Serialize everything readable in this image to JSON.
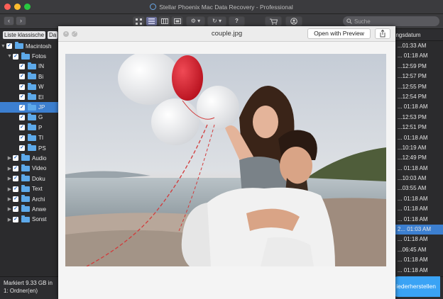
{
  "window": {
    "title": "Stellar Phoenix Mac Data Recovery - Professional"
  },
  "toolbar": {
    "back": "‹",
    "forward": "›",
    "search_placeholder": "Suche"
  },
  "tabs": [
    "Liste klassische",
    "Da"
  ],
  "tree": [
    {
      "label": "Macintosh",
      "level": 0,
      "expanded": true
    },
    {
      "label": "Fotos",
      "level": 1,
      "expanded": true
    },
    {
      "label": "IN",
      "level": 2
    },
    {
      "label": "Bi",
      "level": 2
    },
    {
      "label": "W",
      "level": 2
    },
    {
      "label": "El",
      "level": 2
    },
    {
      "label": "JP",
      "level": 2,
      "selected": true
    },
    {
      "label": "G",
      "level": 2
    },
    {
      "label": "P",
      "level": 2
    },
    {
      "label": "TI",
      "level": 2
    },
    {
      "label": "PS",
      "level": 2
    },
    {
      "label": "Audio",
      "level": 1,
      "expandable": true
    },
    {
      "label": "Video",
      "level": 1,
      "expandable": true
    },
    {
      "label": "Doku",
      "level": 1,
      "expandable": true
    },
    {
      "label": "Text",
      "level": 1,
      "expandable": true
    },
    {
      "label": "Archi",
      "level": 1,
      "expandable": true
    },
    {
      "label": "Anwe",
      "level": 1,
      "expandable": true
    },
    {
      "label": "Sonst",
      "level": 1,
      "expandable": true
    }
  ],
  "right_column": {
    "header": "ungsdatum",
    "rows": [
      "3, ...01:33 AM",
      "2, ... 01:18 AM",
      "2, ...12:59 PM",
      "2, ...12:57 PM",
      "2, ...12:55 PM",
      "2, ...12:54 PM",
      "2, ... 01:18 AM",
      "2, ...12:53 PM",
      "2, ...12:51 PM",
      "2, ... 01:18 AM",
      "2, ...10:19 AM",
      "2, ...12:49 PM",
      "2, ... 01:18 AM",
      "2, ...10:03 AM",
      "2, ...03:55 AM",
      "2, ... 01:18 AM",
      "2, ... 01:18 AM",
      "2, ... 01:18 AM",
      "2, 2... 01:03 AM",
      "2, ... 01:18 AM",
      "2, ...06:45 AM",
      "2, ... 01:18 AM",
      "2, ... 01:18 AM"
    ],
    "selected_index": 18
  },
  "status": {
    "text": "Markiert 9.33 GB in 1: Ordner(en)"
  },
  "restore_button": {
    "label": "iederherstellen"
  },
  "quicklook": {
    "title": "couple.jpg",
    "open_button": "Open with Preview",
    "close": "×",
    "fullscreen": "⤢"
  },
  "colors": {
    "selection": "#3c7fd0",
    "accent": "#3aa3f5",
    "folder": "#5da9ea"
  },
  "icons": [
    "grid-view-icon",
    "list-view-icon",
    "column-view-icon",
    "preview-view-icon",
    "gear-icon",
    "history-icon",
    "help-icon",
    "cart-icon",
    "account-icon",
    "search-icon",
    "share-icon"
  ]
}
